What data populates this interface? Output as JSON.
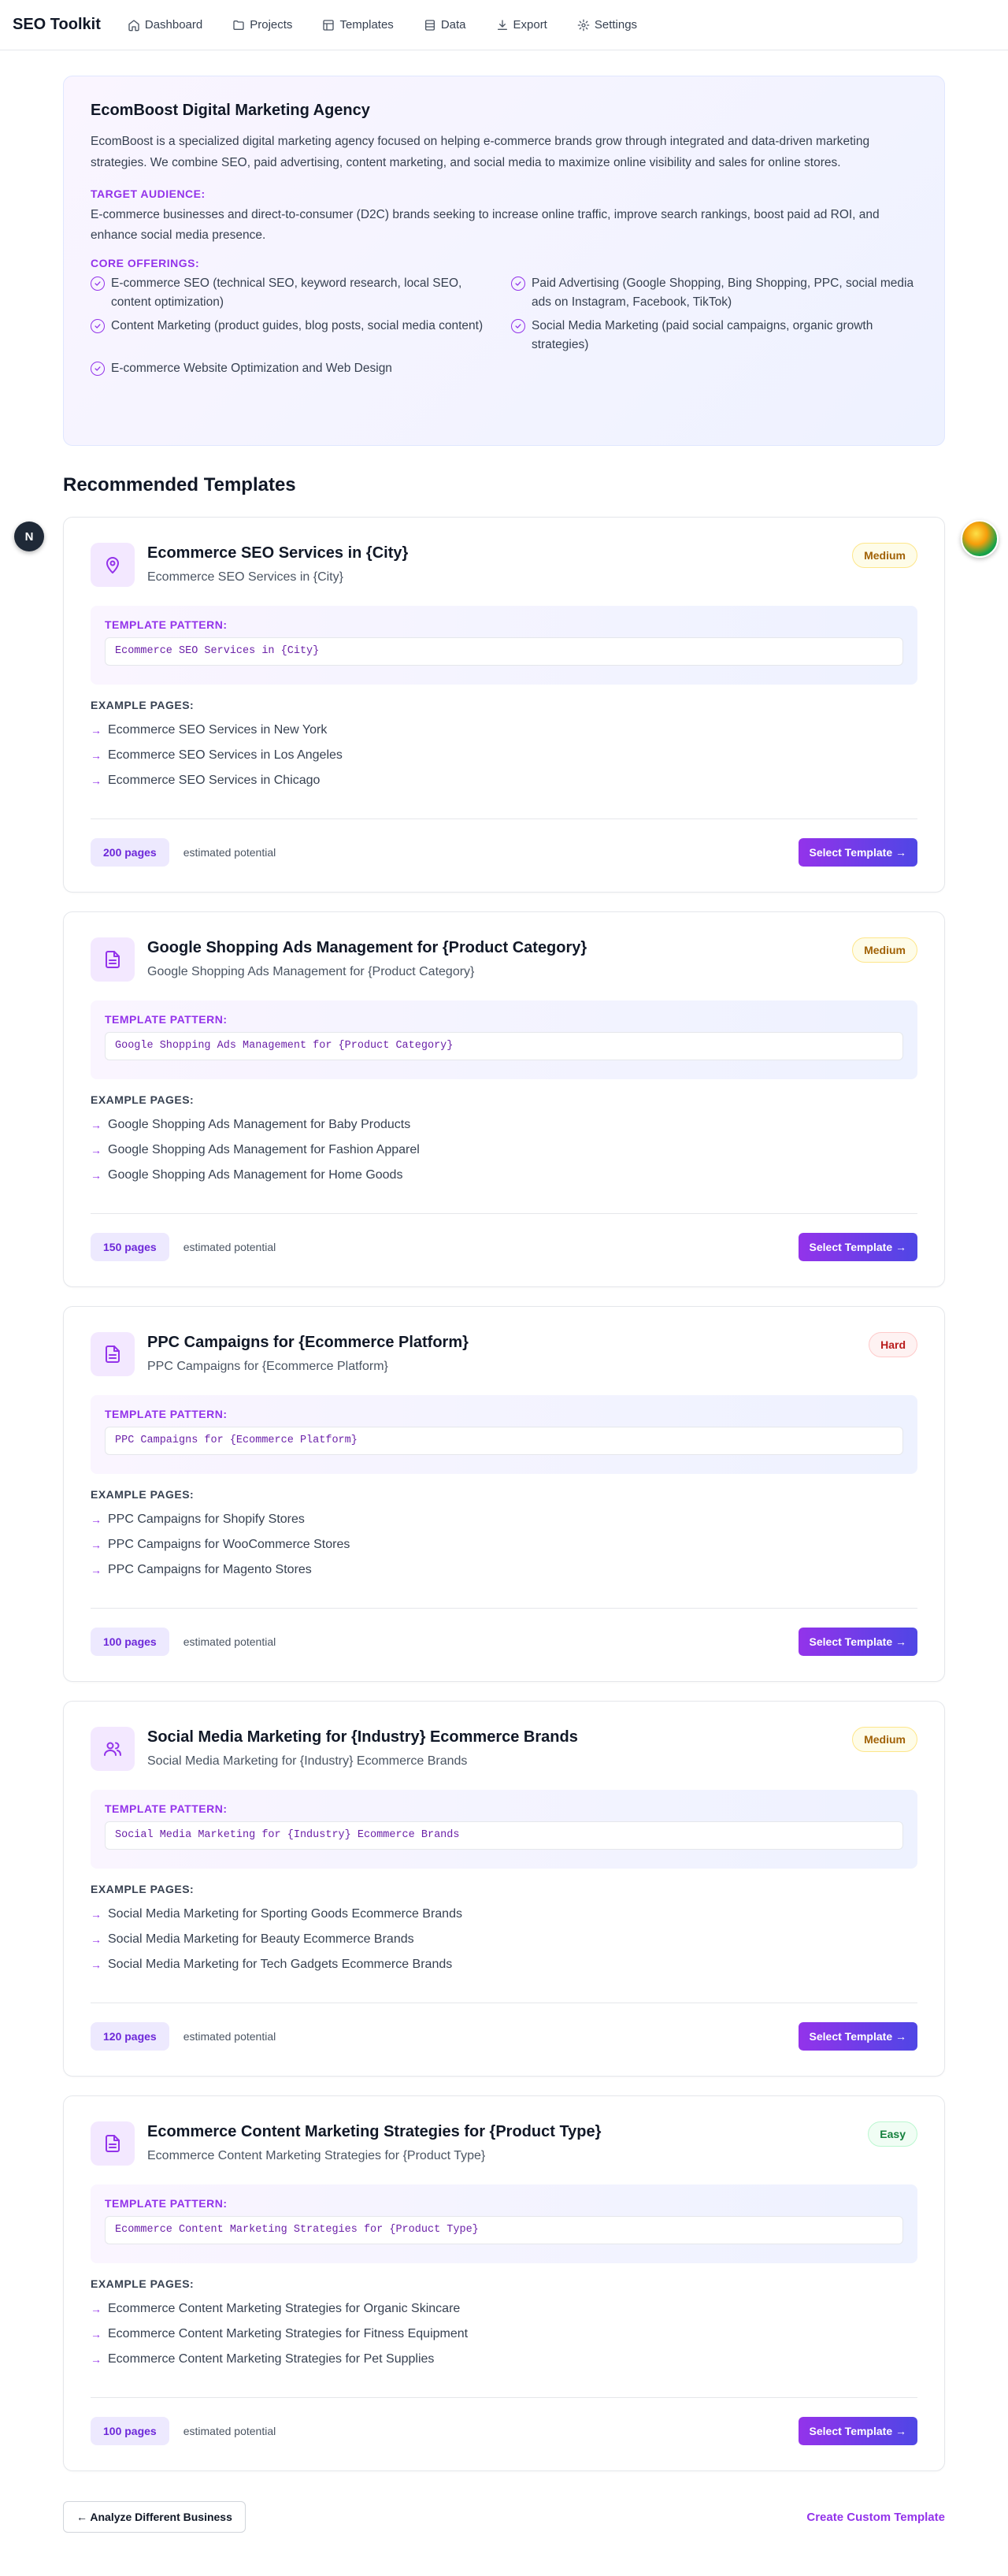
{
  "nav": {
    "brand": "SEO Toolkit",
    "items": [
      {
        "label": "Dashboard",
        "icon": "home-icon"
      },
      {
        "label": "Projects",
        "icon": "folder-icon"
      },
      {
        "label": "Templates",
        "icon": "layout-icon"
      },
      {
        "label": "Data",
        "icon": "database-icon"
      },
      {
        "label": "Export",
        "icon": "download-icon"
      },
      {
        "label": "Settings",
        "icon": "gear-icon"
      }
    ]
  },
  "business": {
    "name": "EcomBoost Digital Marketing Agency",
    "description": "EcomBoost is a specialized digital marketing agency focused on helping e-commerce brands grow through integrated and data-driven marketing strategies. We combine SEO, paid advertising, content marketing, and social media to maximize online visibility and sales for online stores.",
    "audience_label": "TARGET AUDIENCE:",
    "audience": "E-commerce businesses and direct-to-consumer (D2C) brands seeking to increase online traffic, improve search rankings, boost paid ad ROI, and enhance social media presence.",
    "offerings_label": "CORE OFFERINGS:",
    "offerings": [
      "E-commerce SEO (technical SEO, keyword research, local SEO, content optimization)",
      "Paid Advertising (Google Shopping, Bing Shopping, PPC, social media ads on Instagram, Facebook, TikTok)",
      "Content Marketing (product guides, blog posts, social media content)",
      "Social Media Marketing (paid social campaigns, organic growth strategies)",
      "E-commerce Website Optimization and Web Design"
    ]
  },
  "recommended_title": "Recommended Templates",
  "labels": {
    "pattern": "TEMPLATE PATTERN:",
    "examples": "EXAMPLE PAGES:",
    "estimated": "estimated potential",
    "select": "Select Template →"
  },
  "templates": [
    {
      "title": "Ecommerce SEO Services in {City}",
      "subtitle": "Ecommerce SEO Services in {City}",
      "difficulty": "Medium",
      "icon": "map-pin-icon",
      "pattern": "Ecommerce SEO Services in {City}",
      "examples": [
        "Ecommerce SEO Services in New York",
        "Ecommerce SEO Services in Los Angeles",
        "Ecommerce SEO Services in Chicago"
      ],
      "pages": "200 pages"
    },
    {
      "title": "Google Shopping Ads Management for {Product Category}",
      "subtitle": "Google Shopping Ads Management for {Product Category}",
      "difficulty": "Medium",
      "icon": "document-icon",
      "pattern": "Google Shopping Ads Management for {Product Category}",
      "examples": [
        "Google Shopping Ads Management for Baby Products",
        "Google Shopping Ads Management for Fashion Apparel",
        "Google Shopping Ads Management for Home Goods"
      ],
      "pages": "150 pages"
    },
    {
      "title": "PPC Campaigns for {Ecommerce Platform}",
      "subtitle": "PPC Campaigns for {Ecommerce Platform}",
      "difficulty": "Hard",
      "icon": "document-icon",
      "pattern": "PPC Campaigns for {Ecommerce Platform}",
      "examples": [
        "PPC Campaigns for Shopify Stores",
        "PPC Campaigns for WooCommerce Stores",
        "PPC Campaigns for Magento Stores"
      ],
      "pages": "100 pages"
    },
    {
      "title": "Social Media Marketing for {Industry} Ecommerce Brands",
      "subtitle": "Social Media Marketing for {Industry} Ecommerce Brands",
      "difficulty": "Medium",
      "icon": "users-icon",
      "pattern": "Social Media Marketing for {Industry} Ecommerce Brands",
      "examples": [
        "Social Media Marketing for Sporting Goods Ecommerce Brands",
        "Social Media Marketing for Beauty Ecommerce Brands",
        "Social Media Marketing for Tech Gadgets Ecommerce Brands"
      ],
      "pages": "120 pages"
    },
    {
      "title": "Ecommerce Content Marketing Strategies for {Product Type}",
      "subtitle": "Ecommerce Content Marketing Strategies for {Product Type}",
      "difficulty": "Easy",
      "icon": "document-icon",
      "pattern": "Ecommerce Content Marketing Strategies for {Product Type}",
      "examples": [
        "Ecommerce Content Marketing Strategies for Organic Skincare",
        "Ecommerce Content Marketing Strategies for Fitness Equipment",
        "Ecommerce Content Marketing Strategies for Pet Supplies"
      ],
      "pages": "100 pages"
    }
  ],
  "bottom": {
    "analyze": "← Analyze Different Business",
    "custom": "Create Custom Template"
  },
  "floating": {
    "badge_letter": "N"
  },
  "colors": {
    "accent_purple": "#9333ea",
    "accent_indigo": "#4f46e5"
  }
}
